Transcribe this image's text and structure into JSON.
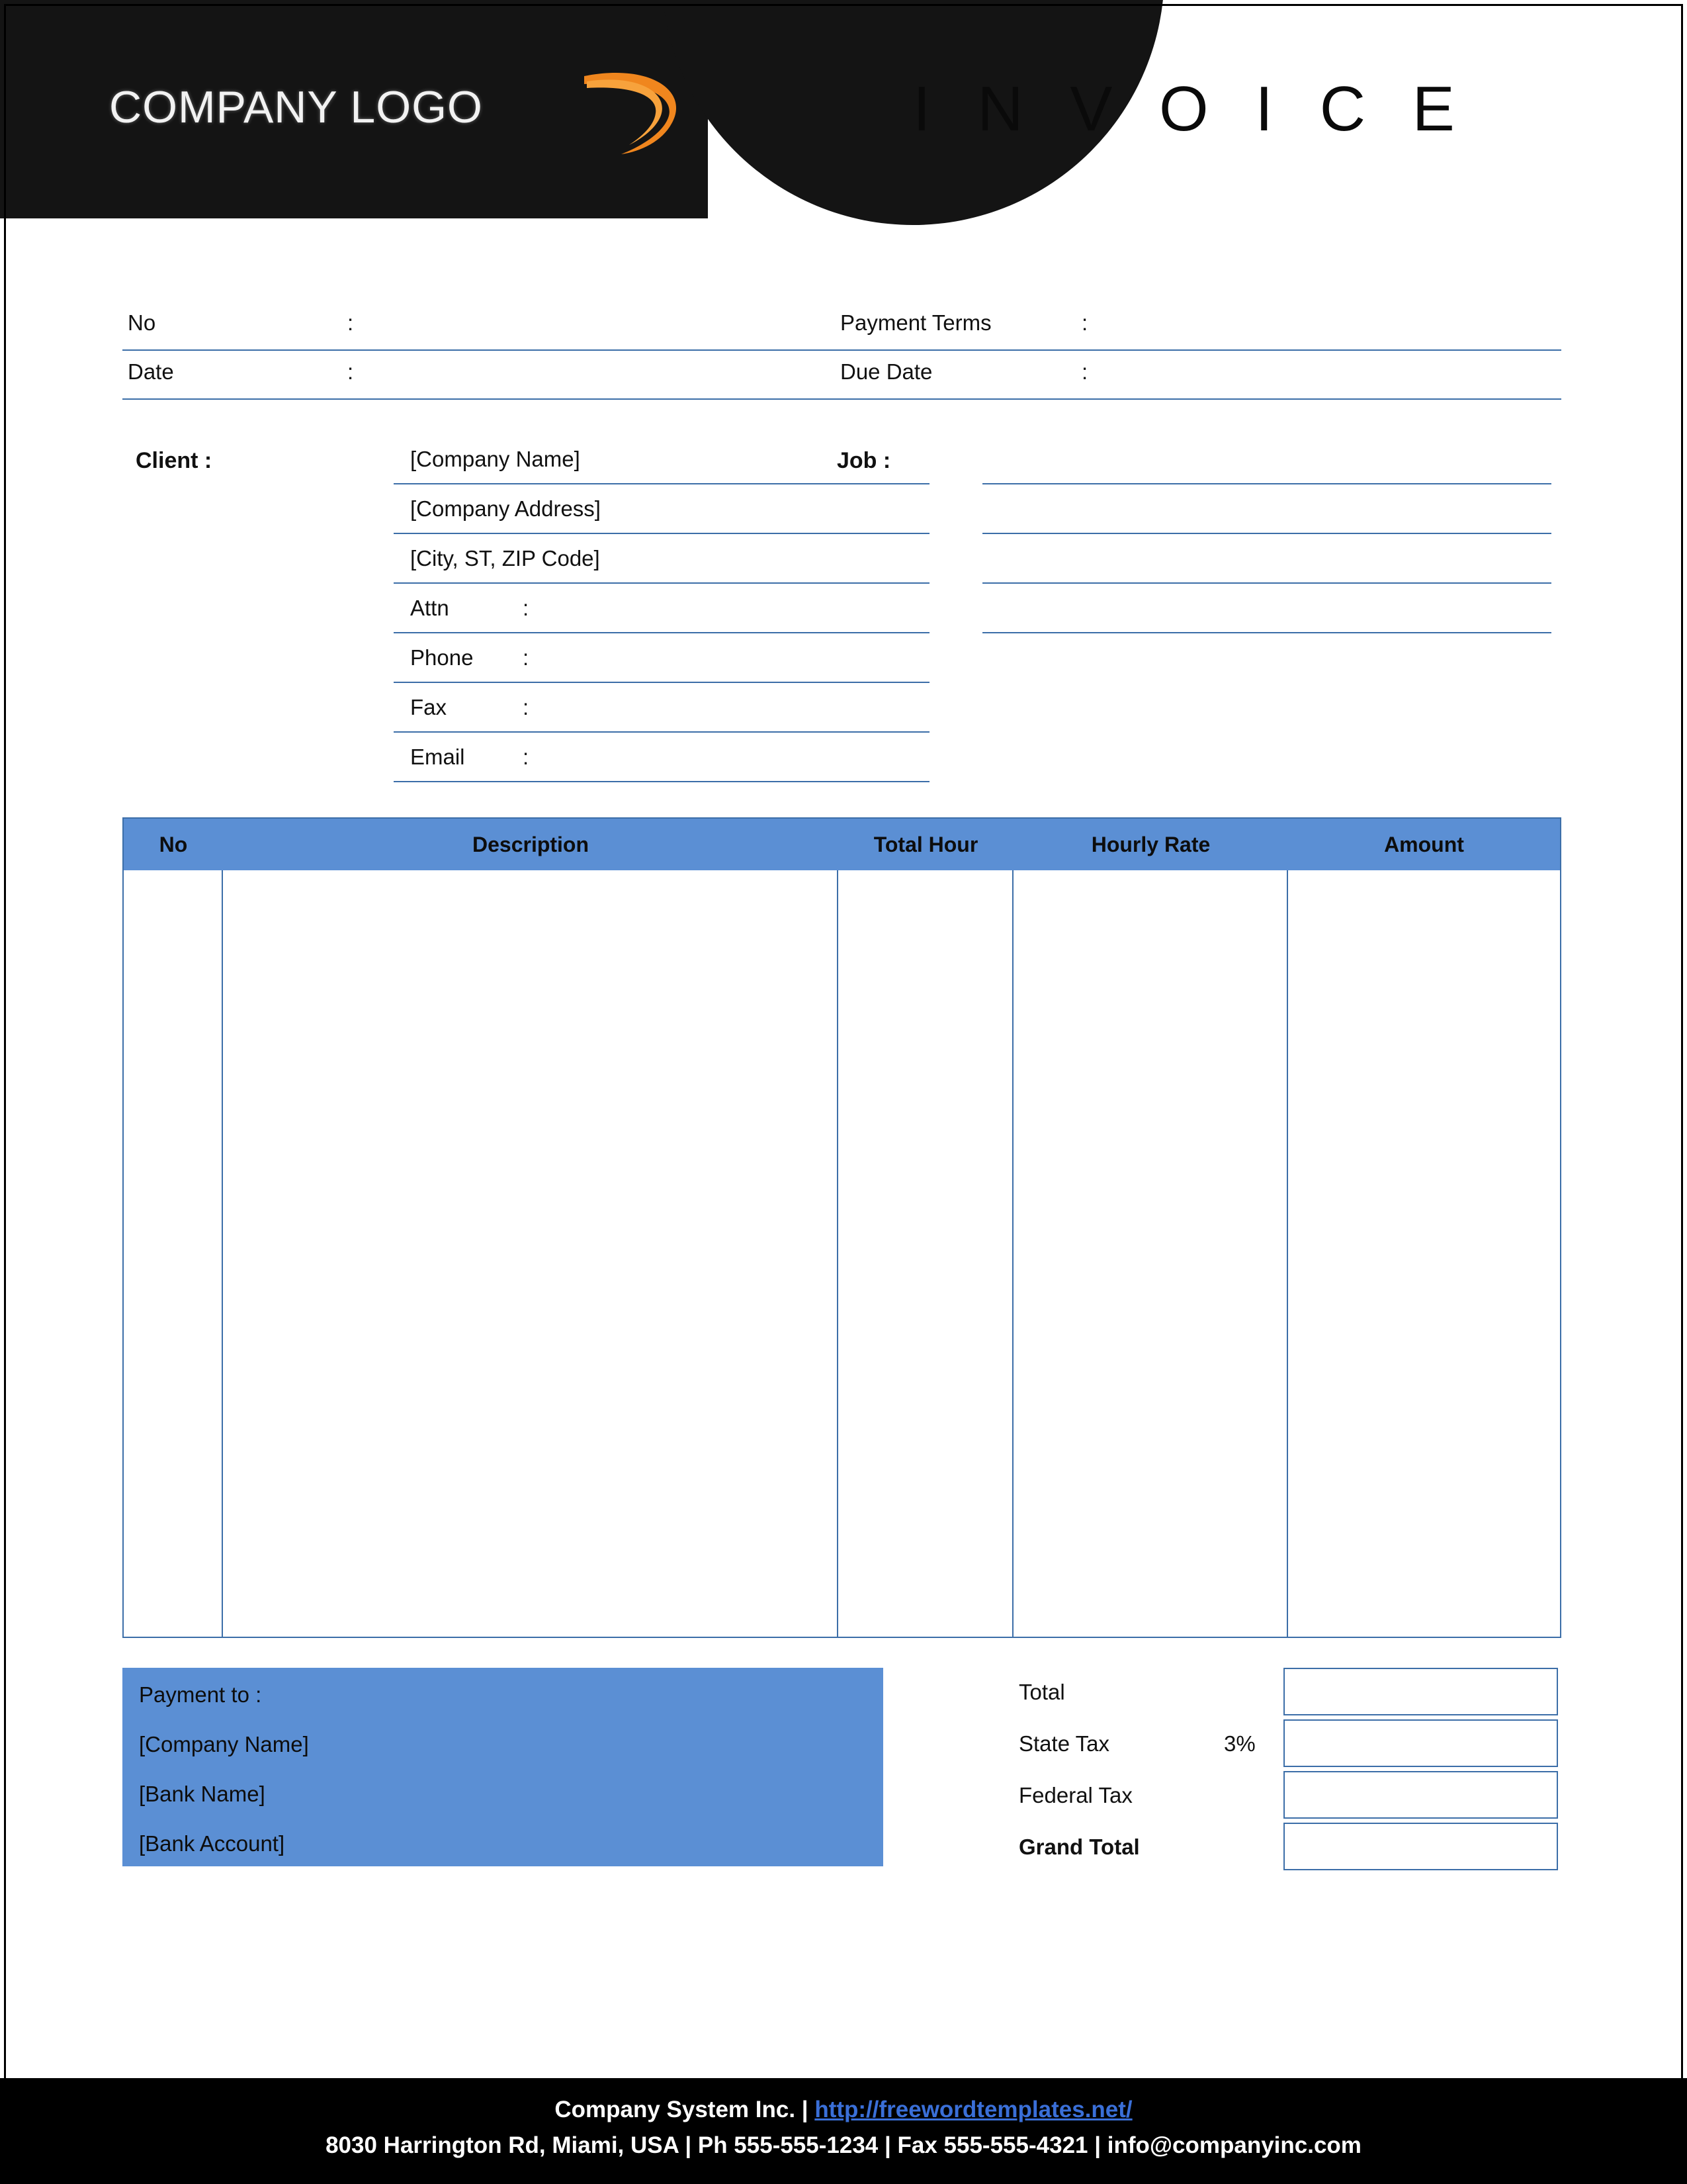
{
  "header": {
    "logo_text": "COMPANY LOGO",
    "logo_icon": "orange-swoosh-icon",
    "invoice_title": "I N V O I C E",
    "accent_color": "#f0861e",
    "banner_color": "#141414"
  },
  "meta": {
    "rows": [
      {
        "left_label": "No",
        "left_colon": ":",
        "right_label": "Payment  Terms",
        "right_colon": ":"
      },
      {
        "left_label": "Date",
        "left_colon": ":",
        "right_label": "Due Date",
        "right_colon": ":"
      }
    ]
  },
  "client": {
    "heading": "Client  :",
    "lines": [
      {
        "text": "[Company Name]",
        "colon": ""
      },
      {
        "text": "[Company Address]",
        "colon": ""
      },
      {
        "text": "[City, ST, ZIP Code]",
        "colon": ""
      },
      {
        "text": "Attn",
        "colon": ":"
      },
      {
        "text": "Phone",
        "colon": ":"
      },
      {
        "text": "Fax",
        "colon": ":"
      },
      {
        "text": "Email",
        "colon": ":"
      }
    ]
  },
  "job": {
    "heading": "Job  :",
    "blank_lines": 4
  },
  "items_table": {
    "columns": [
      "No",
      "Description",
      "Total Hour",
      "Hourly Rate",
      "Amount"
    ],
    "header_bg": "#5b8fd4",
    "border_color": "#3c6ea8",
    "rows": []
  },
  "payment": {
    "bg_color": "#5b8fd4",
    "lines": [
      "Payment to :",
      "[Company Name]",
      "[Bank Name]",
      "[Bank Account]"
    ]
  },
  "totals": {
    "rows": [
      {
        "label": "Total",
        "percent": "",
        "value": "",
        "bold": false
      },
      {
        "label": "State Tax",
        "percent": "3%",
        "value": "",
        "bold": false
      },
      {
        "label": "Federal Tax",
        "percent": "",
        "value": "",
        "bold": false
      },
      {
        "label": "Grand Total",
        "percent": "",
        "value": "",
        "bold": true
      }
    ]
  },
  "footer": {
    "company": "Company System Inc. | ",
    "url": "http://freewordtemplates.net/",
    "address": "8030 Harrington Rd, Miami, USA | Ph 555-555-1234 | Fax 555-555-4321 | info@companyinc.com",
    "link_color": "#3a6fd8"
  }
}
